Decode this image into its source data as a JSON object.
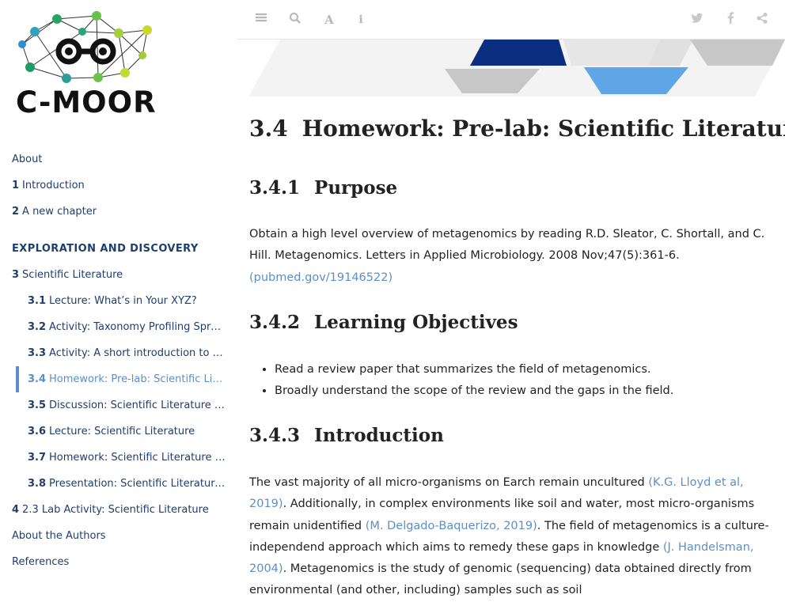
{
  "sidebar": {
    "logo_text": "C-MOOR",
    "nav": [
      {
        "num": "",
        "label": "About"
      },
      {
        "num": "1",
        "label": "Introduction"
      },
      {
        "num": "2",
        "label": "A new chapter"
      },
      {
        "num": "",
        "label": "EXPLORATION AND DISCOVERY"
      },
      {
        "num": "3",
        "label": "Scientific Literature"
      },
      {
        "num": "3.1",
        "label": "Lecture: What’s in Your XYZ?"
      },
      {
        "num": "3.2",
        "label": "Activity: Taxonomy Profiling Spre…"
      },
      {
        "num": "3.3",
        "label": "Activity: A short introduction to G…"
      },
      {
        "num": "3.4",
        "label": "Homework: Pre-lab: Scientific Lite…"
      },
      {
        "num": "3.5",
        "label": "Discussion: Scientific Literature P…"
      },
      {
        "num": "3.6",
        "label": "Lecture: Scientific Literature"
      },
      {
        "num": "3.7",
        "label": "Homework: Scientific Literature A…"
      },
      {
        "num": "3.8",
        "label": "Presentation: Scientific Literature…"
      },
      {
        "num": "4",
        "label": "2.3 Lab Activity: Scientific Literature"
      },
      {
        "num": "",
        "label": "About the Authors"
      },
      {
        "num": "",
        "label": "References"
      }
    ]
  },
  "toolbar": {
    "left_icons": [
      "list-icon",
      "search-icon",
      "font-icon",
      "info-icon"
    ],
    "right_icons": [
      "twitter-icon",
      "facebook-icon",
      "share-icon"
    ]
  },
  "main": {
    "title_num": "3.4",
    "title": "Homework: Pre-lab: Scientific Literature",
    "purpose": {
      "num": "3.4.1",
      "heading": "Purpose",
      "text": "Obtain a high level overview of metagenomics by reading R.D. Sleator, C. Shortall, and C. Hill. Metagenomics. Letters in Applied Microbiology. 2008 Nov;47(5):361-6. ",
      "link": "(pubmed.gov/19146522)"
    },
    "objectives": {
      "num": "3.4.2",
      "heading": "Learning Objectives",
      "items": [
        "Read a review paper that summarizes the field of metagenomics.",
        "Broadly understand the scope of the review and the gaps in the field."
      ]
    },
    "introduction": {
      "num": "3.4.3",
      "heading": "Introduction",
      "t1": "The vast majority of all micro-organisms on Earch remain uncultured ",
      "l1": "(K.G. Lloyd et al, 2019)",
      "t2": ". Additionally, in complex environments like soil and water, most micro-organisms remain unidentified ",
      "l2": "(M. Delgado-Baquerizo, 2019)",
      "t3": ". The field of metagenomics is a culture-independend approach which aims to remedy these gaps in knowledge ",
      "l3": "(J. Handelsman, 2004)",
      "t4": ". Metagenomics is the study of genomic (sequencing) data obtained directly from environmental (and other, including) samples such as soil"
    }
  },
  "colors": {
    "link": "#5b8fc7",
    "nav_text": "#1f3e6c",
    "banner_dark": "#0b2f80",
    "banner_blue": "#5ea6e6",
    "banner_gray": "#c7c7c7"
  }
}
